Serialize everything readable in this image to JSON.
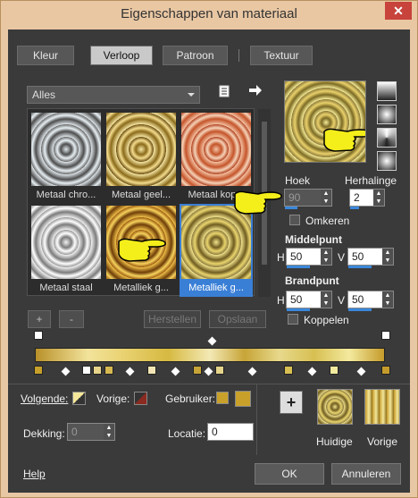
{
  "window": {
    "title": "Eigenschappen van materiaal",
    "close": "✕"
  },
  "tabs": [
    {
      "label": "Kleur"
    },
    {
      "label": "Verloop"
    },
    {
      "label": "Patroon"
    },
    {
      "label": "Textuur"
    }
  ],
  "filter": {
    "value": "Alles"
  },
  "thumbnails": [
    {
      "label": "Metaal chro..."
    },
    {
      "label": "Metaal geel..."
    },
    {
      "label": "Metaal kop..."
    },
    {
      "label": "Metaal staal"
    },
    {
      "label": "Metalliek g..."
    },
    {
      "label": "Metalliek g..."
    }
  ],
  "list_buttons": {
    "add": "+",
    "remove": "-",
    "reset": "Herstellen",
    "save": "Opslaan"
  },
  "angle": {
    "label": "Hoek",
    "value": "90"
  },
  "repeat": {
    "label": "Herhalinge",
    "value": "2"
  },
  "invert": {
    "label": "Omkeren"
  },
  "center": {
    "label": "Middelpunt",
    "h_label": "H",
    "h_value": "50",
    "v_label": "V",
    "v_value": "50"
  },
  "focal": {
    "label": "Brandpunt",
    "h_label": "H",
    "h_value": "50",
    "v_label": "V",
    "v_value": "50"
  },
  "link": {
    "label": "Koppelen"
  },
  "bottom": {
    "foreground_label": "Volgende:",
    "background_label": "Vorige:",
    "user_label": "Gebruiker:",
    "opacity_label": "Dekking:",
    "opacity_value": "0",
    "location_label": "Locatie:",
    "location_value": "0",
    "current_label": "Huidige",
    "previous_label": "Vorige"
  },
  "buttons": {
    "help": "Help",
    "ok": "OK",
    "cancel": "Annuleren"
  },
  "colors": {
    "accent": "#3a87db",
    "gold": "#c9a12a",
    "client_bg": "#3a3a3a"
  }
}
